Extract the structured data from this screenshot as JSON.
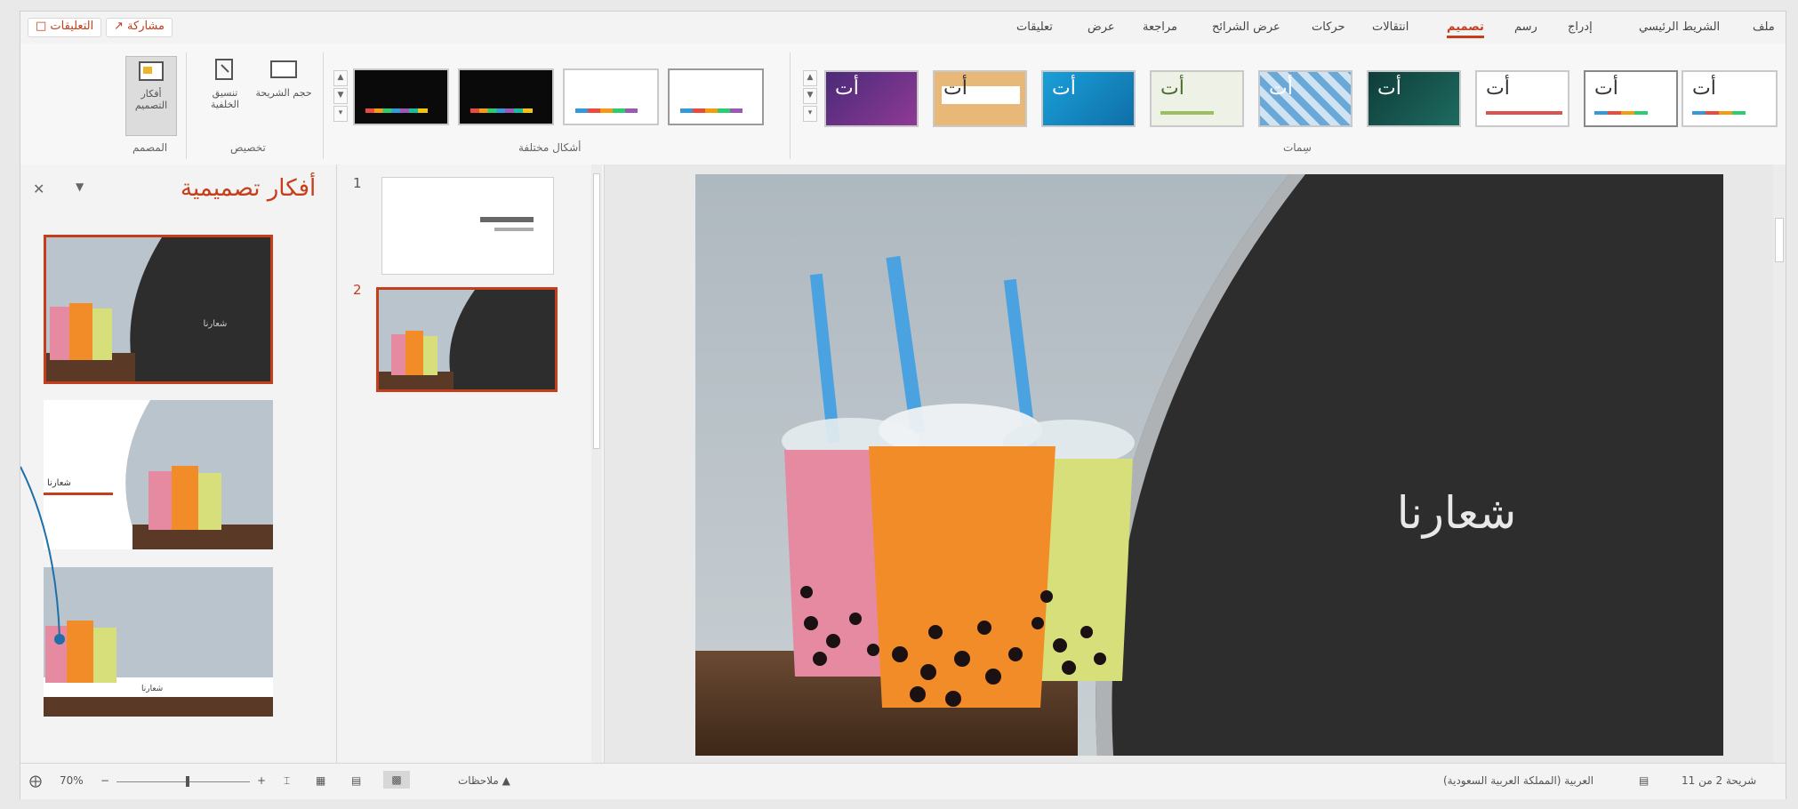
{
  "tabs": [
    "ملف",
    "الشريط الرئيسي",
    "إدراج",
    "رسم",
    "تصميم",
    "انتقالات",
    "حركات",
    "عرض الشرائح",
    "مراجعة",
    "عرض",
    "تعليقات"
  ],
  "active_tab": "تصميم",
  "top_buttons": {
    "share": "مشاركة",
    "comments": "التعليقات"
  },
  "ribbon": {
    "themes_group_label": "سِمات",
    "variants_group_label": "أشكال مختلفة",
    "customize_group_label": "تخصيص",
    "designer_group_label": "المصمم",
    "slide_size_label": "حجم الشريحة",
    "format_background_label": "تنسيق الخلفية",
    "design_ideas_button_label": "أفكار التصميم",
    "theme_glyph": "أت"
  },
  "design_ideas_pane": {
    "title": "أفكار تصميمية"
  },
  "thumbnails": {
    "slide1_number": "1",
    "slide2_number": "2"
  },
  "slide": {
    "title": "شعارنا"
  },
  "status": {
    "zoom": "70%",
    "notes": "ملاحظات",
    "slide_count": "شريحة 2 من 11",
    "language": "العربية (المملكة العربية السعودية)"
  },
  "colors": {
    "accent": "#c43e1c",
    "slide_dark": "#2d2d2d",
    "callout": "#1f6fa8"
  }
}
